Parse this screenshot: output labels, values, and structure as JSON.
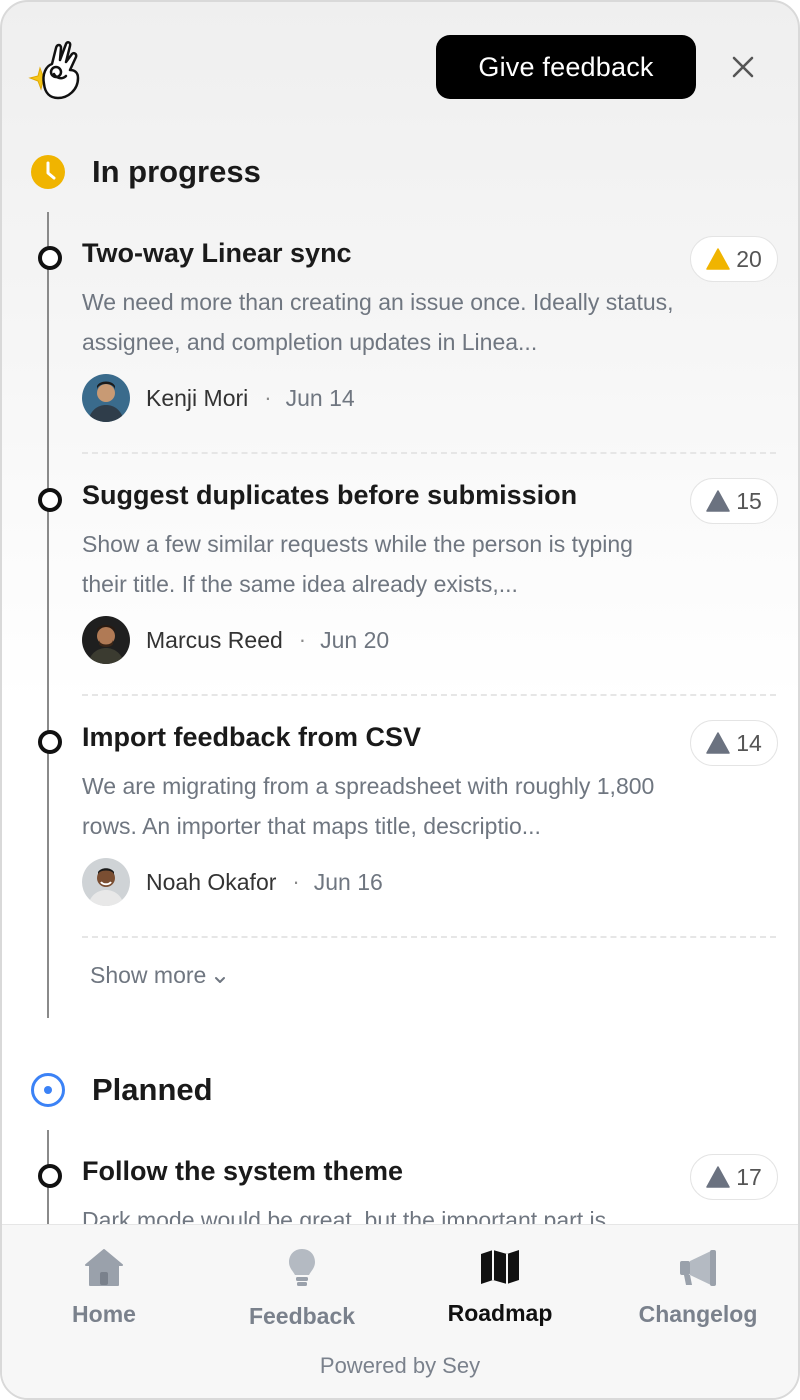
{
  "header": {
    "give_feedback_label": "Give feedback",
    "close_icon": "close-icon",
    "logo_icon": "hand-sparkle-logo"
  },
  "sections": [
    {
      "title": "In progress",
      "icon": "clock-icon",
      "accent_color": "#f0b400",
      "items": [
        {
          "title": "Two-way Linear sync",
          "description": "We need more than creating an issue once. Ideally status, assignee, and completion updates in Linea...",
          "author": "Kenji Mori",
          "date": "Jun 14",
          "votes": "20",
          "voted": true
        },
        {
          "title": "Suggest duplicates before submission",
          "description": "Show a few similar requests while the person is typing their title. If the same idea already exists,...",
          "author": "Marcus Reed",
          "date": "Jun 20",
          "votes": "15",
          "voted": false
        },
        {
          "title": "Import feedback from CSV",
          "description": "We are migrating from a spreadsheet with roughly 1,800 rows. An importer that maps title, descriptio...",
          "author": "Noah Okafor",
          "date": "Jun 16",
          "votes": "14",
          "voted": false
        }
      ],
      "show_more_label": "Show more"
    },
    {
      "title": "Planned",
      "icon": "target-circle-icon",
      "accent_color": "#3b82f6",
      "items": [
        {
          "title": "Follow the system theme",
          "description": "Dark mode would be great, but the important part is",
          "votes": "17",
          "voted": false
        }
      ]
    }
  ],
  "separator": "·",
  "nav": {
    "items": [
      {
        "label": "Home",
        "icon": "home-icon",
        "active": false
      },
      {
        "label": "Feedback",
        "icon": "lightbulb-icon",
        "active": false
      },
      {
        "label": "Roadmap",
        "icon": "map-icon",
        "active": true
      },
      {
        "label": "Changelog",
        "icon": "megaphone-icon",
        "active": false
      }
    ],
    "powered_by": "Powered by Sey"
  },
  "colors": {
    "vote_active": "#f0b400",
    "vote_inactive": "#6b7280",
    "primary_button": "#000000"
  }
}
